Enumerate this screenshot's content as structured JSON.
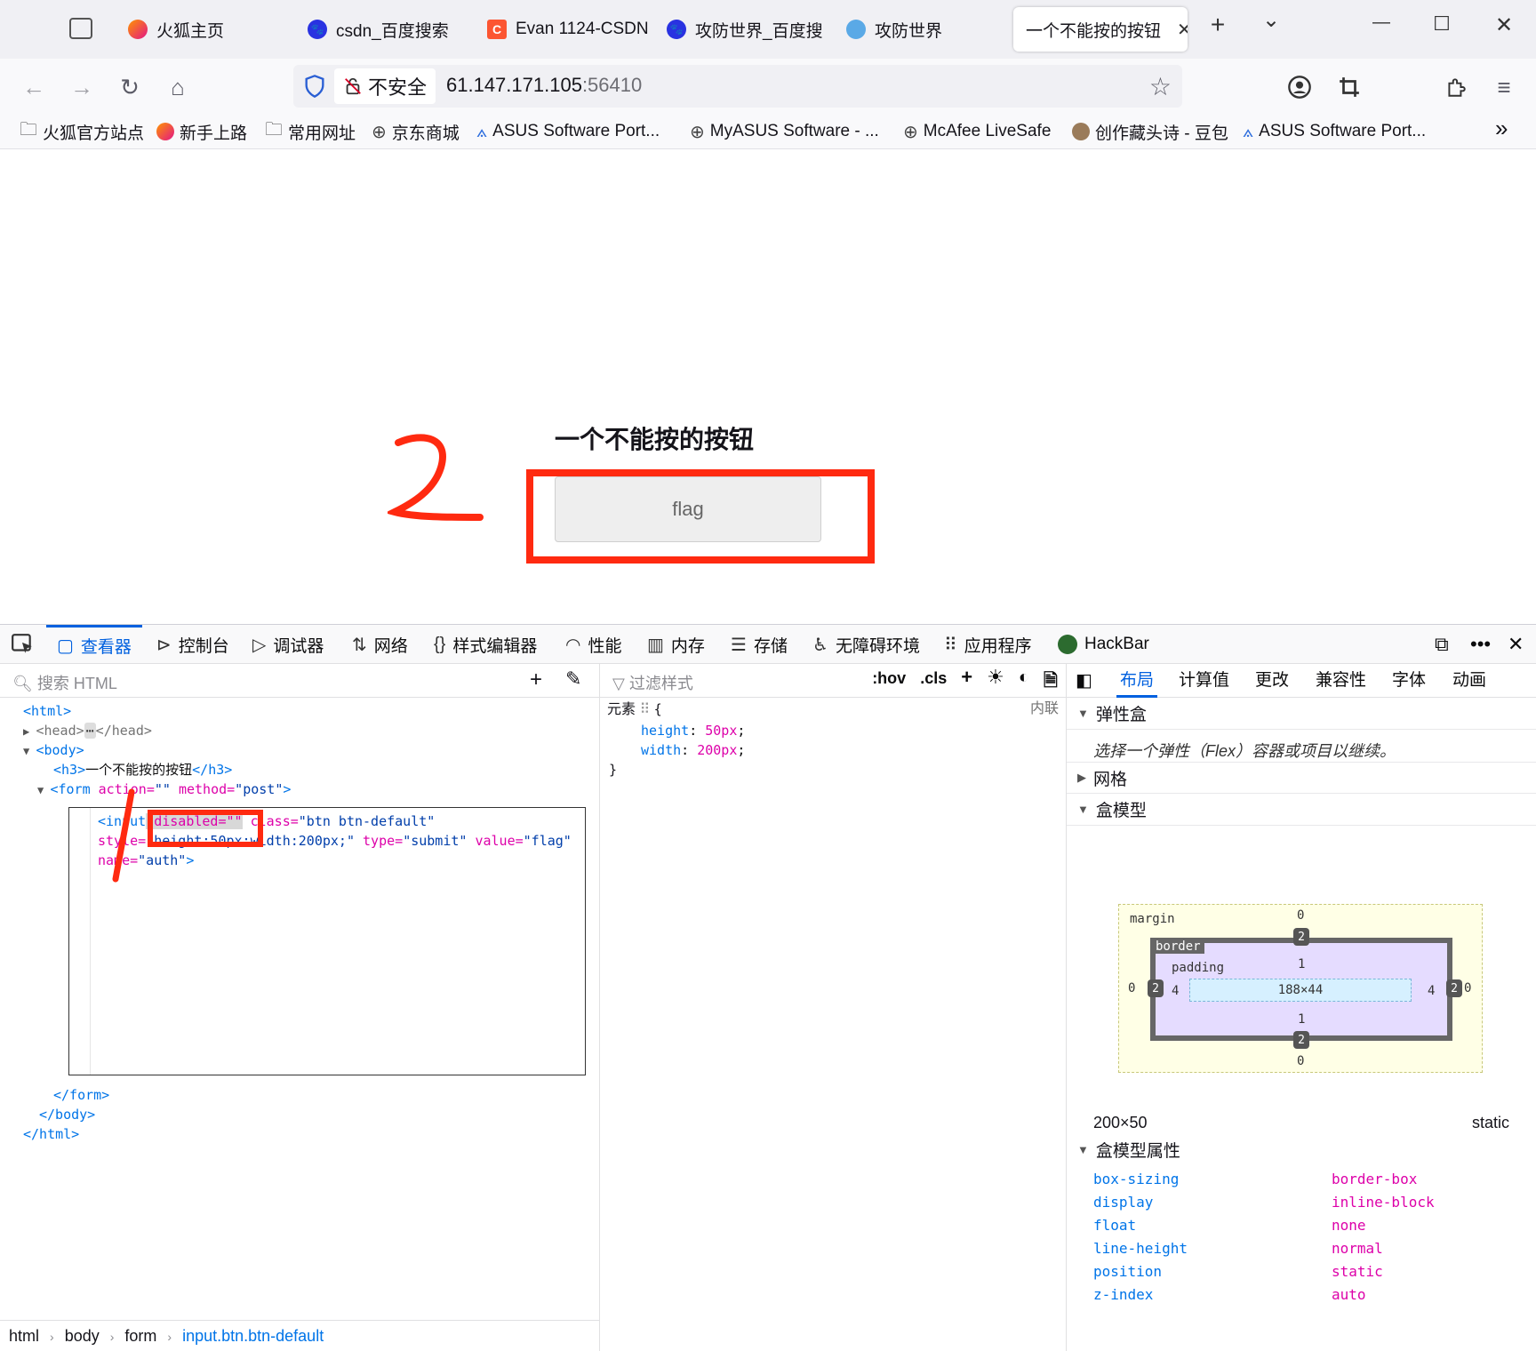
{
  "browser": {
    "tabs": [
      {
        "label": "火狐主页",
        "icon": "firefox-icon"
      },
      {
        "label": "csdn_百度搜索",
        "icon": "baidu-paw-icon"
      },
      {
        "label": "Evan 1124-CSDN",
        "icon": "csdn-icon"
      },
      {
        "label": "攻防世界_百度搜",
        "icon": "baidu-paw-icon"
      },
      {
        "label": "攻防世界",
        "icon": "globe-icon"
      },
      {
        "label": "一个不能按的按钮",
        "icon": "none"
      }
    ],
    "new_tab": "+",
    "tab_list": "⌄",
    "window": {
      "minimize": "—",
      "maximize": "☐",
      "close": "✕"
    }
  },
  "navbar": {
    "security_label": "不安全",
    "url_host": "61.147.171.105",
    "url_port": ":56410"
  },
  "bookmarks": [
    {
      "label": "火狐官方站点",
      "icon": "folder-icon"
    },
    {
      "label": "新手上路",
      "icon": "firefox-icon"
    },
    {
      "label": "常用网址",
      "icon": "folder-icon"
    },
    {
      "label": "京东商城",
      "icon": "globe-icon"
    },
    {
      "label": "ASUS Software Port...",
      "icon": "asus-icon"
    },
    {
      "label": "MyASUS Software - ...",
      "icon": "globe-icon"
    },
    {
      "label": "McAfee LiveSafe",
      "icon": "globe-icon"
    },
    {
      "label": "创作藏头诗 - 豆包",
      "icon": "doubao-icon"
    },
    {
      "label": "ASUS Software Port...",
      "icon": "asus-icon"
    }
  ],
  "bookmarks_overflow": "»",
  "page": {
    "heading": "一个不能按的按钮",
    "button_value": "flag",
    "annotation_2": "2",
    "annotation_1": "1"
  },
  "devtools": {
    "tabs": [
      {
        "label": "查看器",
        "icon": "inspector-icon"
      },
      {
        "label": "控制台",
        "icon": "console-icon"
      },
      {
        "label": "调试器",
        "icon": "debugger-icon"
      },
      {
        "label": "网络",
        "icon": "network-icon"
      },
      {
        "label": "样式编辑器",
        "icon": "braces-icon"
      },
      {
        "label": "性能",
        "icon": "gauge-icon"
      },
      {
        "label": "内存",
        "icon": "memory-icon"
      },
      {
        "label": "存储",
        "icon": "storage-icon"
      },
      {
        "label": "无障碍环境",
        "icon": "accessibility-icon"
      },
      {
        "label": "应用程序",
        "icon": "apps-grid-icon"
      },
      {
        "label": "HackBar",
        "icon": "hackbar-icon"
      }
    ],
    "search_html_placeholder": "搜索 HTML",
    "filter_styles_placeholder": "过滤样式",
    "rules_tools": [
      ":hov",
      ".cls"
    ],
    "markup": {
      "html_open": "<html>",
      "head": "<head>",
      "head_close": "</head>",
      "head_ellipsis": "⋯",
      "body_open": "<body>",
      "h3_open": "<h3>",
      "h3_text": "一个不能按的按钮",
      "h3_close": "</h3>",
      "form_tag": "<form",
      "form_action_attr": " action=",
      "form_action_val": "\"\"",
      "form_method_attr": " method=",
      "form_method_val": "\"post\"",
      "form_end": ">",
      "input_tag": "<input",
      "input_disabled": " disabled=\"\"",
      "input_class_attr": " class=",
      "input_class_val": "\"btn btn-default\"",
      "input_style_attr": "style=",
      "input_style_val": "\"height:50px;width:200px;\"",
      "input_type_attr": " type=",
      "input_type_val": "\"submit\"",
      "input_value_attr": " value=",
      "input_value_val": "\"flag\"",
      "input_name_attr": "name=",
      "input_name_val": "\"auth\"",
      "input_end": ">",
      "form_close": "</form>",
      "body_close": "</body>",
      "html_close": "</html>"
    },
    "rule": {
      "selector": "元素",
      "brace_open": "{",
      "inline_label": "内联",
      "decls": [
        {
          "prop": "height",
          "value": "50px"
        },
        {
          "prop": "width",
          "value": "200px"
        }
      ],
      "brace_close": "}"
    },
    "breadcrumbs": [
      "html",
      "body",
      "form",
      "input.btn.btn-default"
    ],
    "layout_tabs": [
      "布局",
      "计算值",
      "更改",
      "兼容性",
      "字体",
      "动画"
    ],
    "flexbox": {
      "title": "弹性盒",
      "hint": "选择一个弹性（Flex）容器或项目以继续。"
    },
    "grid_title": "网格",
    "boxmodel_title": "盒模型",
    "boxmodel": {
      "margin_label": "margin",
      "border_label": "border",
      "padding_label": "padding",
      "margin": {
        "top": "0",
        "right": "0",
        "bottom": "0",
        "left": "0"
      },
      "border": {
        "top": "2",
        "right": "2",
        "bottom": "2",
        "left": "2"
      },
      "padding": {
        "top": "1",
        "right": "4",
        "bottom": "1",
        "left": "4"
      },
      "content": "188×44",
      "size": "200×50",
      "position": "static"
    },
    "box_props_title": "盒模型属性",
    "box_props": [
      {
        "name": "box-sizing",
        "value": "border-box"
      },
      {
        "name": "display",
        "value": "inline-block"
      },
      {
        "name": "float",
        "value": "none"
      },
      {
        "name": "line-height",
        "value": "normal"
      },
      {
        "name": "position",
        "value": "static"
      },
      {
        "name": "z-index",
        "value": "auto"
      }
    ]
  },
  "colors": {
    "annotation_red": "#ff2a10",
    "accent_blue": "#0060df"
  }
}
